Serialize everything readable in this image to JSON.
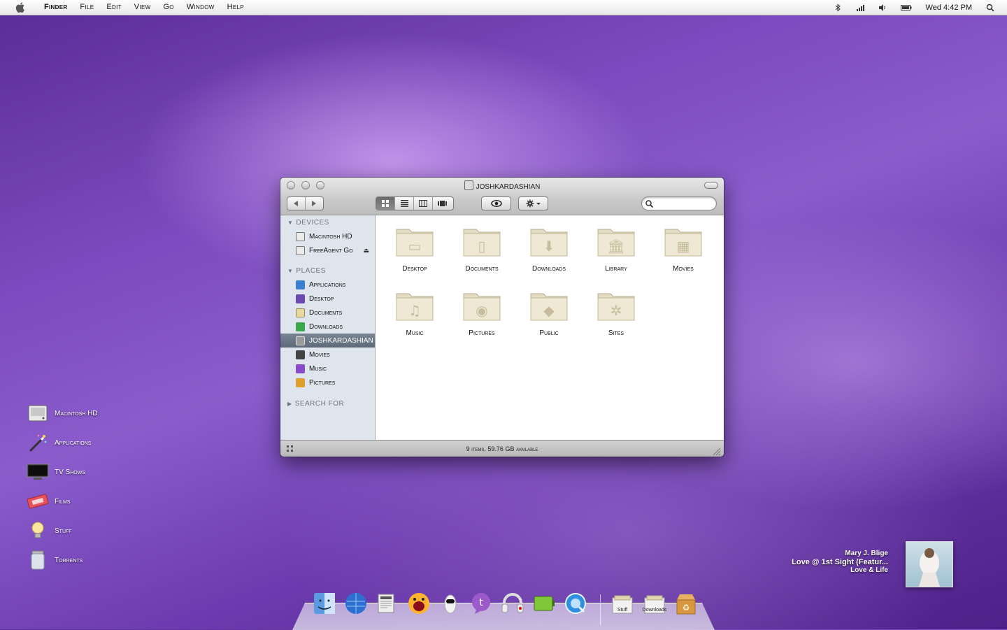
{
  "menubar": {
    "items": [
      "Finder",
      "File",
      "Edit",
      "View",
      "Go",
      "Window",
      "Help"
    ],
    "clock": "Wed 4:42 PM"
  },
  "desktop": {
    "items": [
      {
        "label": "Macintosh HD",
        "icon": "hard-drive-icon"
      },
      {
        "label": "Applications",
        "icon": "magic-wand-icon"
      },
      {
        "label": "TV Shows",
        "icon": "tv-icon"
      },
      {
        "label": "Films",
        "icon": "ticket-icon"
      },
      {
        "label": "Stuff",
        "icon": "lightbulb-icon"
      },
      {
        "label": "Torrents",
        "icon": "jar-icon"
      }
    ]
  },
  "window": {
    "title": "JOSHKARDASHIAN",
    "status": "9 items, 59.76 GB available",
    "sidebar": {
      "devices_heading": "DEVICES",
      "devices": [
        {
          "label": "Macintosh HD"
        },
        {
          "label": "FreeAgent Go"
        }
      ],
      "places_heading": "PLACES",
      "places": [
        {
          "label": "Applications",
          "color": "#3b7fd0"
        },
        {
          "label": "Desktop",
          "color": "#6b4ab0"
        },
        {
          "label": "Documents",
          "color": "#e8d9a0"
        },
        {
          "label": "Downloads",
          "color": "#3aa84a"
        },
        {
          "label": "JOSHKARDASHIAN",
          "color": "#999999"
        },
        {
          "label": "Movies",
          "color": "#444444"
        },
        {
          "label": "Music",
          "color": "#8a4bc8"
        },
        {
          "label": "Pictures",
          "color": "#e0a030"
        }
      ],
      "search_heading": "SEARCH FOR"
    },
    "folders": [
      {
        "label": "Desktop",
        "glyph": "▭"
      },
      {
        "label": "Documents",
        "glyph": "▯"
      },
      {
        "label": "Downloads",
        "glyph": "⬇"
      },
      {
        "label": "Library",
        "glyph": "🏛"
      },
      {
        "label": "Movies",
        "glyph": "▦"
      },
      {
        "label": "Music",
        "glyph": "♫"
      },
      {
        "label": "Pictures",
        "glyph": "◉"
      },
      {
        "label": "Public",
        "glyph": "◆"
      },
      {
        "label": "Sites",
        "glyph": "✲"
      }
    ]
  },
  "now_playing": {
    "artist": "Mary J. Blige",
    "song": "Love @ 1st Sight (Featur...",
    "album": "Love & Life"
  },
  "dock": {
    "items": [
      {
        "name": "finder"
      },
      {
        "name": "browser"
      },
      {
        "name": "newspaper"
      },
      {
        "name": "screaming"
      },
      {
        "name": "robot"
      },
      {
        "name": "messenger"
      },
      {
        "name": "headphones"
      },
      {
        "name": "battery"
      },
      {
        "name": "quicktime"
      }
    ],
    "stacks": [
      {
        "label": "Stuff"
      },
      {
        "label": "Downloads"
      }
    ],
    "trash": "recycle"
  }
}
